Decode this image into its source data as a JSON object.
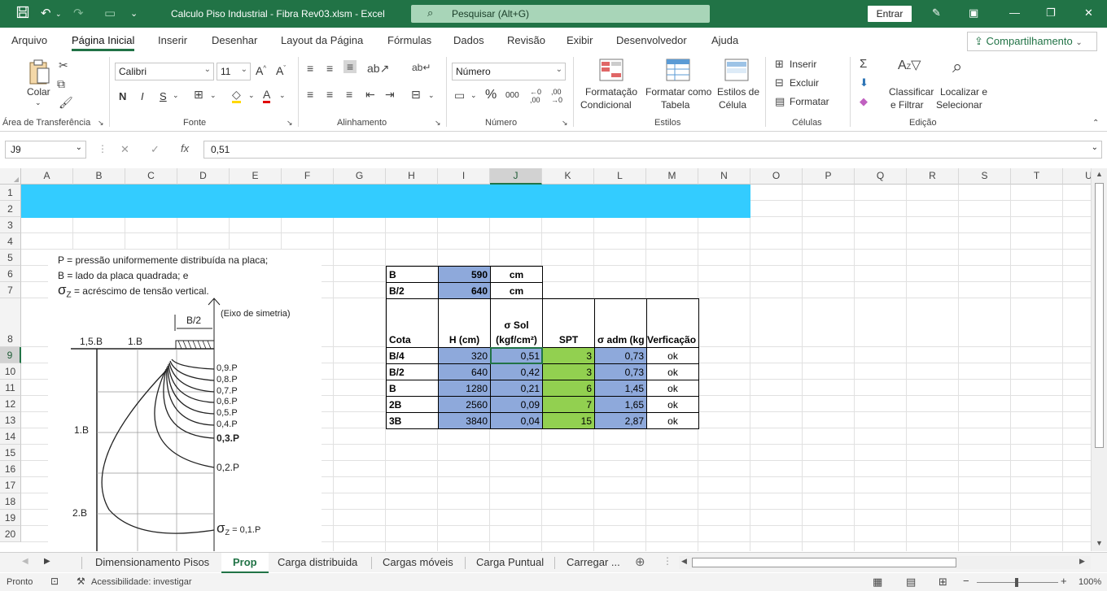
{
  "app": {
    "title": "Calculo Piso Industrial - Fibra Rev03.xlsm  -  Excel",
    "search_placeholder": "Pesquisar (Alt+G)",
    "signin_label": "Entrar",
    "accent_color": "#217346"
  },
  "menu": {
    "tabs": [
      "Arquivo",
      "Página Inicial",
      "Inserir",
      "Desenhar",
      "Layout da Página",
      "Fórmulas",
      "Dados",
      "Revisão",
      "Exibir",
      "Desenvolvedor",
      "Ajuda"
    ],
    "active": "Página Inicial",
    "share_label": "Compartilhamento"
  },
  "ribbon": {
    "clipboard": {
      "paste_label": "Colar",
      "group_label": "Área de Transferência"
    },
    "font": {
      "name": "Calibri",
      "size": "11",
      "bold": "N",
      "italic": "I",
      "underline": "S",
      "group_label": "Fonte"
    },
    "alignment": {
      "group_label": "Alinhamento"
    },
    "number": {
      "format": "Número",
      "group_label": "Número"
    },
    "styles": {
      "conditional_l1": "Formatação",
      "conditional_l2": "Condicional",
      "table_l1": "Formatar como",
      "table_l2": "Tabela",
      "cell_l1": "Estilos de",
      "cell_l2": "Célula",
      "group_label": "Estilos"
    },
    "cells": {
      "insert": "Inserir",
      "delete": "Excluir",
      "format": "Formatar",
      "group_label": "Células"
    },
    "editing": {
      "sort_l1": "Classificar",
      "sort_l2": "e Filtrar",
      "find_l1": "Localizar e",
      "find_l2": "Selecionar",
      "group_label": "Edição"
    }
  },
  "formula_bar": {
    "name_box": "J9",
    "formula": "0,51"
  },
  "columns": [
    "A",
    "B",
    "C",
    "D",
    "E",
    "F",
    "G",
    "H",
    "I",
    "J",
    "K",
    "L",
    "M",
    "N",
    "O",
    "P",
    "Q",
    "R",
    "S",
    "T",
    "U"
  ],
  "selected_column": "J",
  "rows": [
    "1",
    "2",
    "3",
    "4",
    "5",
    "6",
    "7",
    "8",
    "9",
    "10",
    "11",
    "12",
    "13",
    "14",
    "15",
    "16",
    "17",
    "18",
    "19",
    "20"
  ],
  "selected_row": "9",
  "header_band_color": "#33ccff",
  "table_top": [
    {
      "label": "B",
      "value": "590",
      "unit": "cm"
    },
    {
      "label": "B/2",
      "value": "640",
      "unit": "cm"
    }
  ],
  "table_headers": {
    "cota": "Cota",
    "h": "H (cm)",
    "sigma_l1": "σ Sol",
    "sigma_l2": "(kgf/cm²)",
    "spt": "SPT",
    "sadm": "σ adm (kg",
    "verif": "Verficação"
  },
  "table_rows": [
    {
      "cota": "B/4",
      "h": "320",
      "sigma": "0,51",
      "spt": "3",
      "sadm": "0,73",
      "verif": "ok"
    },
    {
      "cota": "B/2",
      "h": "640",
      "sigma": "0,42",
      "spt": "3",
      "sadm": "0,73",
      "verif": "ok"
    },
    {
      "cota": "B",
      "h": "1280",
      "sigma": "0,21",
      "spt": "6",
      "sadm": "1,45",
      "verif": "ok"
    },
    {
      "cota": "2B",
      "h": "2560",
      "sigma": "0,09",
      "spt": "7",
      "sadm": "1,65",
      "verif": "ok"
    },
    {
      "cota": "3B",
      "h": "3840",
      "sigma": "0,04",
      "spt": "15",
      "sadm": "2,87",
      "verif": "ok"
    }
  ],
  "colors": {
    "blue_cell": "#8ea9db",
    "green_cell": "#92d050"
  },
  "figure": {
    "line1": "P = pressão uniformemente distribuída na placa;",
    "line2": "B = lado da placa quadrada; e",
    "line3_sym": "σ",
    "line3_sub": "Z",
    "line3_rest": "= acréscimo de tensão vertical.",
    "half_b": "B/2",
    "axis_label": "(Eixo de simetria)",
    "top_15b": "1,5.B",
    "top_1b": "1.B",
    "left_1b": "1.B",
    "left_2b": "2.B",
    "curves": [
      "0,9.P",
      "0,8.P",
      "0,7.P",
      "0,6.P",
      "0,5.P",
      "0,4.P",
      "0,3.P",
      "0,2.P"
    ],
    "sigma_last_sym": "σ",
    "sigma_last_sub": "Z",
    "sigma_last_val": "= 0,1.P"
  },
  "sheets": {
    "tabs": [
      "Dimensionamento Pisos",
      "Prop",
      "Carga distribuida",
      "Cargas móveis",
      "Carga Puntual",
      "Carregar ..."
    ],
    "active": "Prop"
  },
  "status": {
    "ready": "Pronto",
    "accessibility": "Acessibilidade: investigar",
    "zoom": "100%"
  }
}
